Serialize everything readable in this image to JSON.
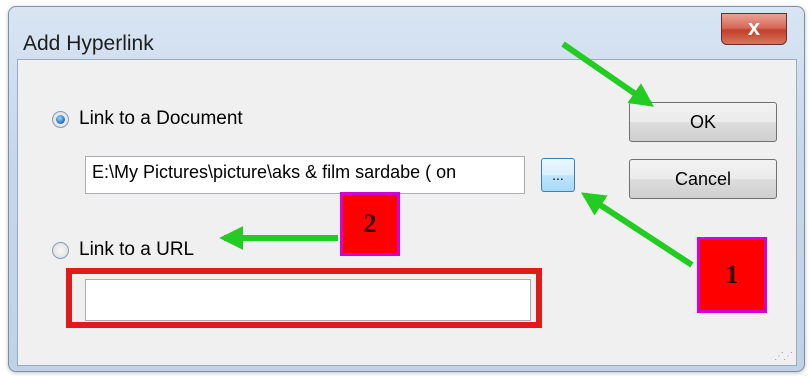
{
  "dialog": {
    "title": "Add Hyperlink",
    "close_glyph": "x"
  },
  "options": {
    "document_label": "Link to a Document",
    "document_path": "E:\\My Pictures\\picture\\aks & film sardabe ( on",
    "browse_label": "...",
    "url_label": "Link to a URL",
    "url_value": ""
  },
  "buttons": {
    "ok": "OK",
    "cancel": "Cancel"
  },
  "annotations": {
    "marker_1": "1",
    "marker_2": "2",
    "arrow_color": "#22cc22",
    "marker_color": "#ff0000",
    "highlight_color": "#e01b1b"
  },
  "state": {
    "document_selected": true,
    "url_selected": false
  }
}
